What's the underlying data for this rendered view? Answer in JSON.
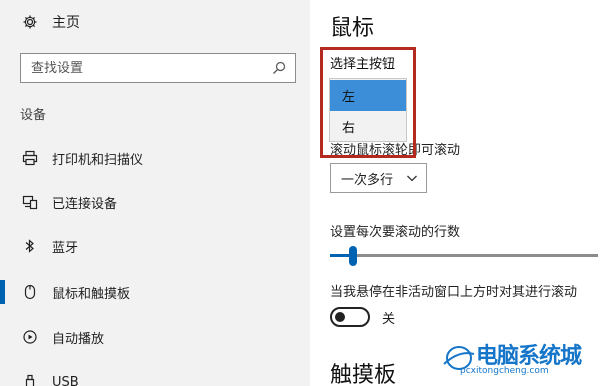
{
  "sidebar": {
    "home_label": "主页",
    "search_placeholder": "查找设置",
    "section_label": "设备",
    "items": [
      {
        "label": "打印机和扫描仪",
        "icon": "printer-icon"
      },
      {
        "label": "已连接设备",
        "icon": "connected-devices-icon"
      },
      {
        "label": "蓝牙",
        "icon": "bluetooth-icon"
      },
      {
        "label": "鼠标和触摸板",
        "icon": "mouse-icon",
        "active": true
      },
      {
        "label": "自动播放",
        "icon": "autoplay-icon"
      },
      {
        "label": "USB",
        "icon": "usb-icon"
      }
    ],
    "accent_color": "#0063b1"
  },
  "main": {
    "title": "鼠标",
    "primary_button": {
      "label": "选择主按钮",
      "options": [
        "左",
        "右"
      ],
      "selected": "左"
    },
    "scroll_setting": {
      "label": "滚动鼠标滚轮即可滚动",
      "value": "一次多行"
    },
    "lines_setting": {
      "label": "设置每次要滚动的行数",
      "slider_fraction": 0.07
    },
    "inactive_scroll": {
      "label": "当我悬停在非活动窗口上方时对其进行滚动",
      "state": "关"
    },
    "touchpad_title": "触摸板"
  },
  "watermark": {
    "title": "电脑系统城",
    "url": "pcxitongcheng.com"
  },
  "colors": {
    "highlight": "#b52a1f",
    "dropdown_selected": "#3d8ed8"
  }
}
